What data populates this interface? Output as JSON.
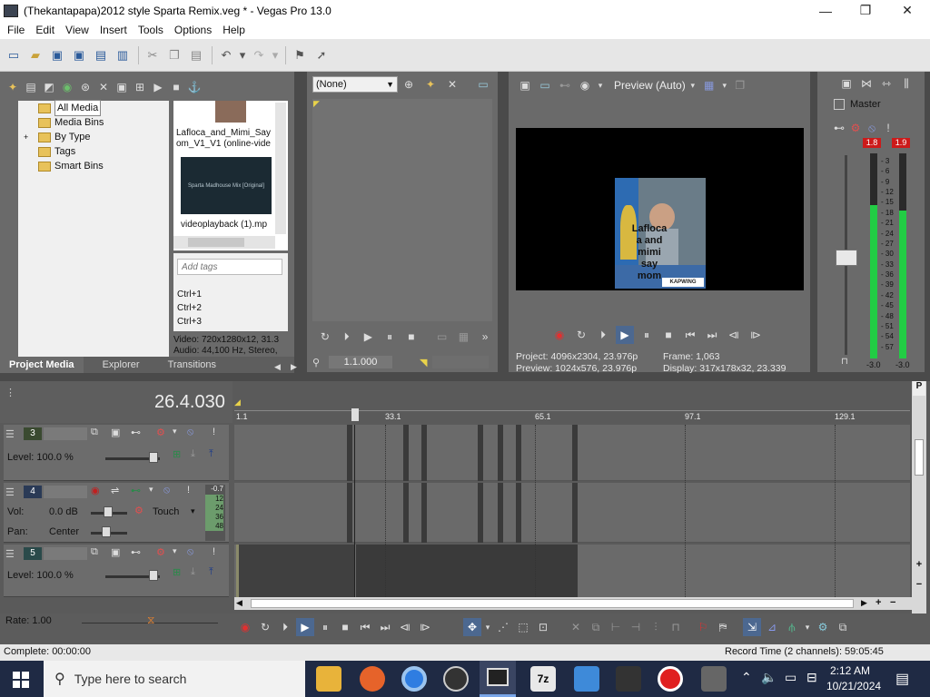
{
  "window": {
    "title": "(Thekantapapa)2012 style Sparta Remix.veg * - Vegas Pro 13.0",
    "controls": [
      "—",
      "❐",
      "✕"
    ]
  },
  "menu": [
    "File",
    "Edit",
    "View",
    "Insert",
    "Tools",
    "Options",
    "Help"
  ],
  "media_tree": {
    "items": [
      "All Media",
      "Media Bins",
      "By Type",
      "Tags",
      "Smart Bins"
    ],
    "expander": "+"
  },
  "media_files": {
    "item1_label": "Lafloca_and_Mimi_Say\nom_V1_V1 (online-vide",
    "item2_thumb_text": "Sparta Madhouse Mix [Original]",
    "item2_label": "videoplayback (1).mp",
    "tag_placeholder": "Add tags",
    "shortcuts": [
      "Ctrl+1",
      "Ctrl+2",
      "Ctrl+3"
    ],
    "info_video": "Video: 720x1280x12, 31.3",
    "info_audio": "Audio: 44,100 Hz, Stereo,"
  },
  "left_tabs": [
    "Project Media",
    "Explorer",
    "Transitions"
  ],
  "trimmer": {
    "dropdown": "(None)",
    "timecode": "1.1.000"
  },
  "preview": {
    "quality": "Preview (Auto)",
    "overlay_text": "Lafloca\na and\nmimi\nsay\nmom",
    "watermark": "KAPWING",
    "project": "Project:  4096x2304, 23.976p",
    "preview": "Preview:  1024x576, 23.976p",
    "frame": "Frame:     1,063",
    "display": "Display:   317x178x32, 23.339"
  },
  "master": {
    "label": "Master",
    "peak_left": "1.8",
    "peak_right": "1.9",
    "scale": [
      "3",
      "6",
      "9",
      "12",
      "15",
      "18",
      "21",
      "24",
      "27",
      "30",
      "33",
      "36",
      "39",
      "42",
      "45",
      "48",
      "51",
      "54",
      "57"
    ],
    "bottom_left": "-3.0",
    "bottom_right": "-3.0",
    "level_left": 0.75,
    "level_right": 0.72
  },
  "timeline": {
    "time": "26.4.030",
    "ruler": [
      "1.1",
      "33.1",
      "65.1",
      "97.1",
      "129.1"
    ],
    "tracks": [
      {
        "num": "3",
        "level": "Level: 100.0 %"
      },
      {
        "num": "4",
        "vol_label": "Vol:",
        "vol": "0.0 dB",
        "pan_label": "Pan:",
        "pan": "Center",
        "mode": "Touch",
        "meter_top": "-0.7",
        "meter_scale": [
          "12",
          "24",
          "36",
          "48"
        ]
      },
      {
        "num": "5",
        "level": "Level: 100.0 %"
      }
    ]
  },
  "rate": "Rate: 1.00",
  "status": {
    "left": "Complete: 00:00:00",
    "right": "Record Time (2 channels): 59:05:45"
  },
  "taskbar": {
    "search": "Type here to search",
    "time": "2:12 AM",
    "date": "10/21/2024"
  }
}
